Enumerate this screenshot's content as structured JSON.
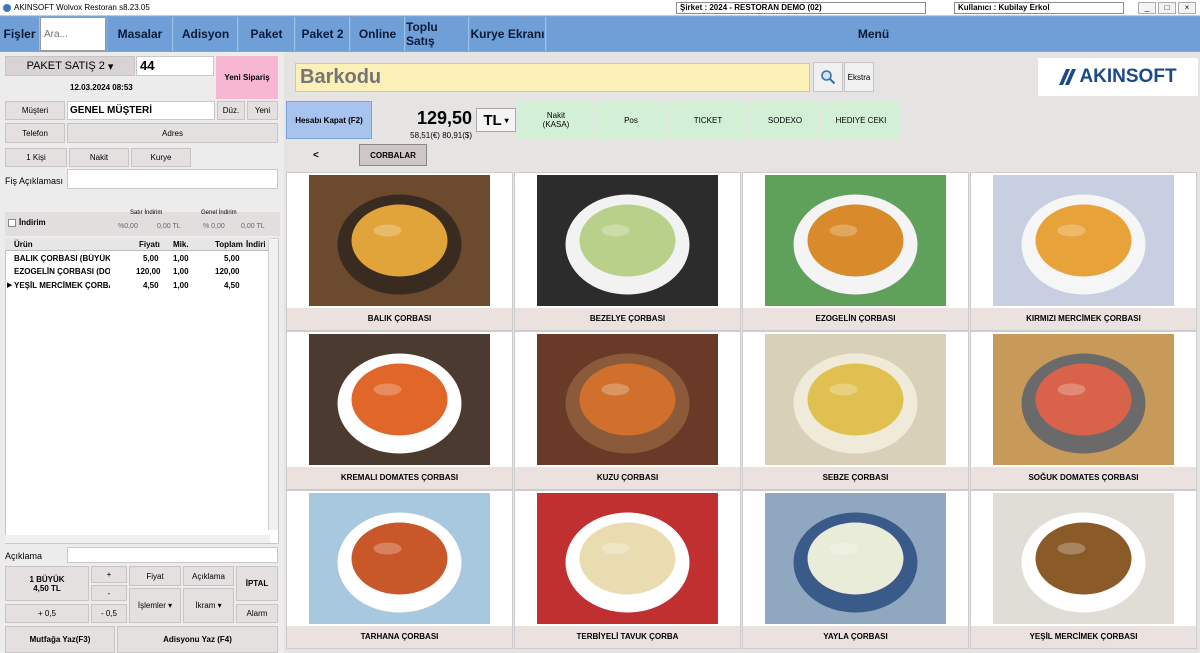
{
  "window": {
    "title": "AKINSOFT Wolvox Restoran s8.23.05",
    "company": "Şirket : 2024 - RESTORAN DEMO (02)",
    "user": "Kullanıcı : Kubilay Erkol"
  },
  "menu": {
    "fisler": "Fişler",
    "search_placeholder": "Ara...",
    "items": [
      "Masalar",
      "Adisyon",
      "Paket",
      "Paket 2",
      "Online",
      "Toplu Satış",
      "Kurye Ekranı"
    ],
    "right": "Menü"
  },
  "order": {
    "type": "PAKET SATIŞ 2",
    "number": "44",
    "datetime": "12.03.2024 08:53",
    "new_order": "Yeni Sipariş"
  },
  "customer": {
    "label": "Müşteri",
    "name": "GENEL MÜŞTERİ",
    "edit": "Düz.",
    "new": "Yeni",
    "phone_label": "Telefon",
    "address_label": "Adres"
  },
  "options": {
    "persons": "1 Kişi",
    "payment": "Nakit",
    "courier": "Kurye"
  },
  "note": {
    "label": "Fiş Açıklaması"
  },
  "discount": {
    "label": "İndirim",
    "sale_label": "Satır İndirim",
    "general_label": "Genel İndirim",
    "sale_pct": "%0,00",
    "sale_tl": "0,00 TL",
    "gen_pct": "% 0,00",
    "gen_tl": "0,00 TL"
  },
  "table": {
    "headers": [
      "Ürün",
      "Fiyatı",
      "Mik.",
      "Toplam",
      "İndiri"
    ],
    "rows": [
      {
        "name": "BALIK ÇORBASI (BÜYÜK",
        "price": "5,00",
        "qty": "1,00",
        "total": "5,00"
      },
      {
        "name": "EZOGELİN ÇORBASI (DOU",
        "price": "120,00",
        "qty": "1,00",
        "total": "120,00"
      },
      {
        "name": "YEŞİL MERCİMEK ÇORBA",
        "price": "4,50",
        "qty": "1,00",
        "total": "4,50"
      }
    ]
  },
  "bottom": {
    "aciklama": "Açıklama",
    "selected_line1": "1 BÜYÜK",
    "selected_line2": "4,50 TL",
    "plus": "+",
    "minus": "-",
    "plus_half": "+ 0,5",
    "minus_half": "- 0,5",
    "fiyat": "Fiyat",
    "aciklama_btn": "Açıklama",
    "islemler": "İşlemler ▾",
    "ikram": "İkram ▾",
    "iptal": "İPTAL",
    "alarm": "Alarm",
    "kitchen": "Mutfağa Yaz(F3)",
    "print": "Adisyonu Yaz (F4)"
  },
  "barcode": {
    "placeholder": "Barkodu",
    "extra": "Ekstra",
    "logo": "AKINSOFT"
  },
  "payment": {
    "close": "Hesabı Kapat (F2)",
    "total": "129,50",
    "foreign": "58,51(€) 80,91($)",
    "currency": "TL",
    "methods": [
      "Nakit\n(KASA)",
      "Pos",
      "TICKET",
      "SODEXO",
      "HEDIYE CEKI"
    ]
  },
  "category": {
    "back": "<",
    "active": "CORBALAR"
  },
  "products": [
    {
      "name": "BALIK ÇORBASI",
      "soup": "#e0a43a",
      "bowl": "#3a2b20",
      "bg": "#6b4a2e"
    },
    {
      "name": "BEZELYE ÇORBASI",
      "soup": "#b9d08a",
      "bowl": "#f2f2f2",
      "bg": "#2c2c2c"
    },
    {
      "name": "EZOGELİN ÇORBASI",
      "soup": "#d98a2a",
      "bowl": "#f4f4f4",
      "bg": "#5fa05a"
    },
    {
      "name": "KIRMIZI MERCİMEK ÇORBASI",
      "soup": "#e8a23a",
      "bowl": "#f6f6f6",
      "bg": "#c7cfe0"
    },
    {
      "name": "KREMALI DOMATES ÇORBASI",
      "soup": "#e0662a",
      "bowl": "#ffffff",
      "bg": "#4a3a30"
    },
    {
      "name": "KUZU  ÇORBASI",
      "soup": "#d0702c",
      "bowl": "#8b5a3a",
      "bg": "#6a3a28"
    },
    {
      "name": "SEBZE ÇORBASI",
      "soup": "#e0c050",
      "bowl": "#f0ead8",
      "bg": "#d8d0b8"
    },
    {
      "name": "SOĞUK DOMATES ÇORBASI",
      "soup": "#d8624a",
      "bowl": "#6a6a6a",
      "bg": "#c89a5a"
    },
    {
      "name": "TARHANA ÇORBASI",
      "soup": "#c8582a",
      "bowl": "#ffffff",
      "bg": "#a8c8e0"
    },
    {
      "name": "TERBİYELİ TAVUK ÇORBA",
      "soup": "#e8dcb0",
      "bowl": "#ffffff",
      "bg": "#c03030"
    },
    {
      "name": "YAYLA ÇORBASI",
      "soup": "#e8ecd8",
      "bowl": "#3a5a8a",
      "bg": "#8fa8c0"
    },
    {
      "name": "YEŞİL MERCİMEK ÇORBASI",
      "soup": "#8a5a28",
      "bowl": "#ffffff",
      "bg": "#e0dcd6"
    }
  ]
}
